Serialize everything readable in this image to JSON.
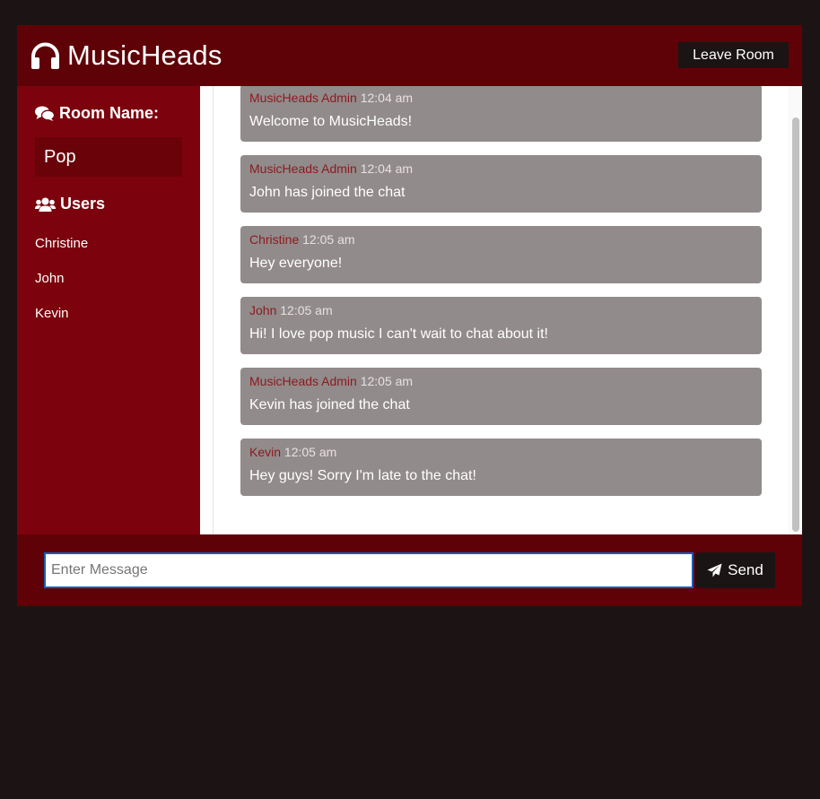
{
  "header": {
    "logo_icon": "headphones-icon",
    "app_name": "MusicHeads",
    "leave_label": "Leave Room"
  },
  "sidebar": {
    "room_heading": "Room Name:",
    "room_icon": "comments-icon",
    "room_name": "Pop",
    "users_heading": "Users",
    "users_icon": "users-icon",
    "users": [
      "Christine",
      "John",
      "Kevin"
    ]
  },
  "messages": [
    {
      "sender": "MusicHeads Admin",
      "time": "12:04 am",
      "text": "Welcome to MusicHeads!"
    },
    {
      "sender": "MusicHeads Admin",
      "time": "12:04 am",
      "text": "John has joined the chat"
    },
    {
      "sender": "Christine",
      "time": "12:05 am",
      "text": "Hey everyone!"
    },
    {
      "sender": "John",
      "time": "12:05 am",
      "text": "Hi! I love pop music I can't wait to chat about it!"
    },
    {
      "sender": "MusicHeads Admin",
      "time": "12:05 am",
      "text": "Kevin has joined the chat"
    },
    {
      "sender": "Kevin",
      "time": "12:05 am",
      "text": "Hey guys! Sorry I'm late to the chat!"
    }
  ],
  "form": {
    "input_value": "",
    "placeholder": "Enter Message",
    "send_label": "Send",
    "send_icon": "paper-plane-icon"
  },
  "colors": {
    "background": "#1c1414",
    "header": "#5e0207",
    "sidebar": "#7c030d",
    "message_bg": "#928b8b",
    "sender": "#8b1a1f",
    "button": "#1b1414"
  }
}
